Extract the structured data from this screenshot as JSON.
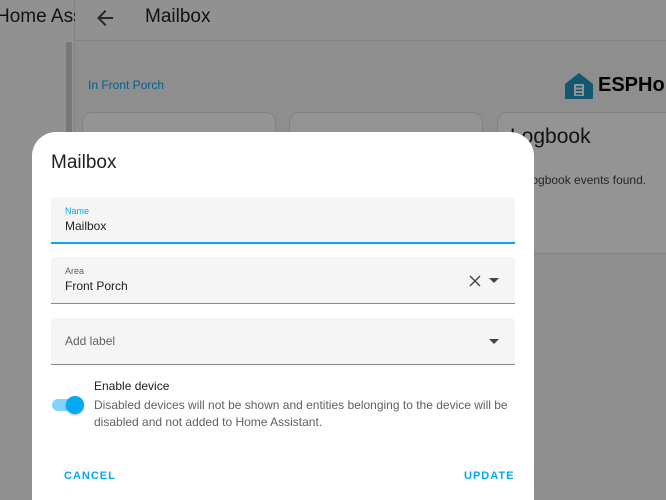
{
  "sidebar": {
    "title": "Home Assistant"
  },
  "header": {
    "title": "Mailbox",
    "back_icon": "arrow-left-icon"
  },
  "page": {
    "area_link": "In Front Porch",
    "integration_logo_text": "ESPHome",
    "logbook": {
      "title": "Logbook",
      "empty_text": "No logbook events found."
    }
  },
  "dialog": {
    "title": "Mailbox",
    "name_field": {
      "label": "Name",
      "value": "Mailbox"
    },
    "area_field": {
      "label": "Area",
      "value": "Front Porch"
    },
    "label_field": {
      "placeholder": "Add label"
    },
    "enable_device": {
      "title": "Enable device",
      "description": "Disabled devices will not be shown and entities belonging to the device will be disabled and not added to Home Assistant.",
      "enabled": true
    },
    "cancel_label": "CANCEL",
    "update_label": "UPDATE"
  },
  "colors": {
    "accent": "#03a9f4",
    "accent_light": "#81d4fa"
  }
}
